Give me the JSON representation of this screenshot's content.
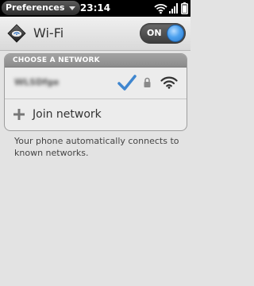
{
  "status_bar": {
    "app_menu_label": "Preferences",
    "app_menu_caret_icon": "caret-down-icon",
    "time": "23:14",
    "icons": [
      "wifi-signal-icon",
      "cellular-signal-icon",
      "battery-icon"
    ]
  },
  "header": {
    "icon": "wifi-app-icon",
    "title": "Wi-Fi",
    "toggle": {
      "label": "ON",
      "state": "on",
      "knob_color": "#3d8fe2"
    }
  },
  "network_list": {
    "header": "CHOOSE A NETWORK",
    "networks": [
      {
        "name": "WLSDfge",
        "name_obscured": true,
        "connected": true,
        "secured": true,
        "icons": [
          "checkmark-icon",
          "lock-icon",
          "wifi-signal-icon"
        ]
      }
    ],
    "join": {
      "icon": "plus-icon",
      "label": "Join network"
    }
  },
  "help_text": "Your phone automatically connects to known networks.",
  "colors": {
    "checkmark": "#3f86cf",
    "background": "#e3e3e3",
    "group_header": "#959595"
  }
}
